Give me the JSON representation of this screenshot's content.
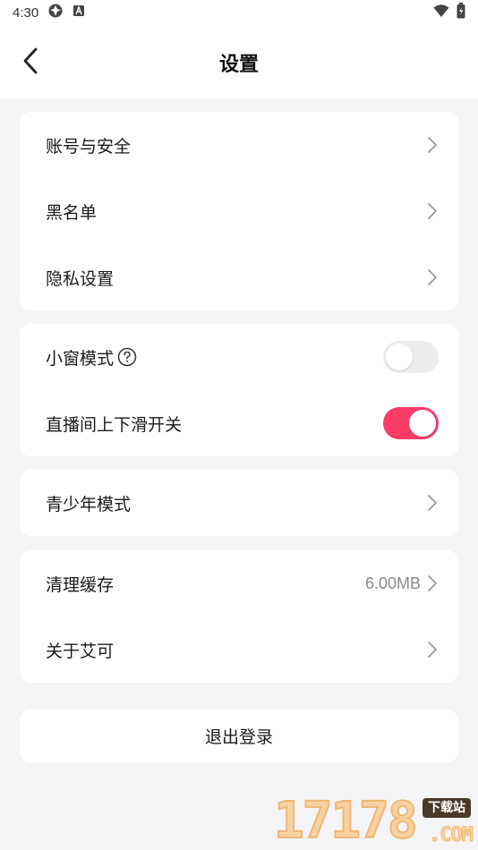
{
  "status_bar": {
    "time": "4:30",
    "icons_left": [
      "system-icon",
      "text-input-icon"
    ],
    "icons_right": [
      "wifi-icon",
      "battery-icon"
    ]
  },
  "header": {
    "title": "设置",
    "back_icon": "chevron-left-icon"
  },
  "group_account": {
    "items": [
      {
        "label": "账号与安全"
      },
      {
        "label": "黑名单"
      },
      {
        "label": "隐私设置"
      }
    ]
  },
  "group_toggles": {
    "items": [
      {
        "label": "小窗模式",
        "help_icon": "question-circle-icon",
        "enabled": false
      },
      {
        "label": "直播间上下滑开关",
        "enabled": true
      }
    ]
  },
  "group_youth": {
    "items": [
      {
        "label": "青少年模式"
      }
    ]
  },
  "group_storage": {
    "items": [
      {
        "label": "清理缓存",
        "value": "6.00MB"
      },
      {
        "label": "关于艾可"
      }
    ]
  },
  "logout": {
    "label": "退出登录"
  },
  "watermark": {
    "digits": "17178",
    "tag": "下载站",
    "suffix": ".COM"
  },
  "colors": {
    "accent": "#fb3d66",
    "background": "#f4f4f6",
    "card": "#ffffff",
    "toggle_off": "#ececec",
    "secondary_text": "#8a8a8a"
  }
}
